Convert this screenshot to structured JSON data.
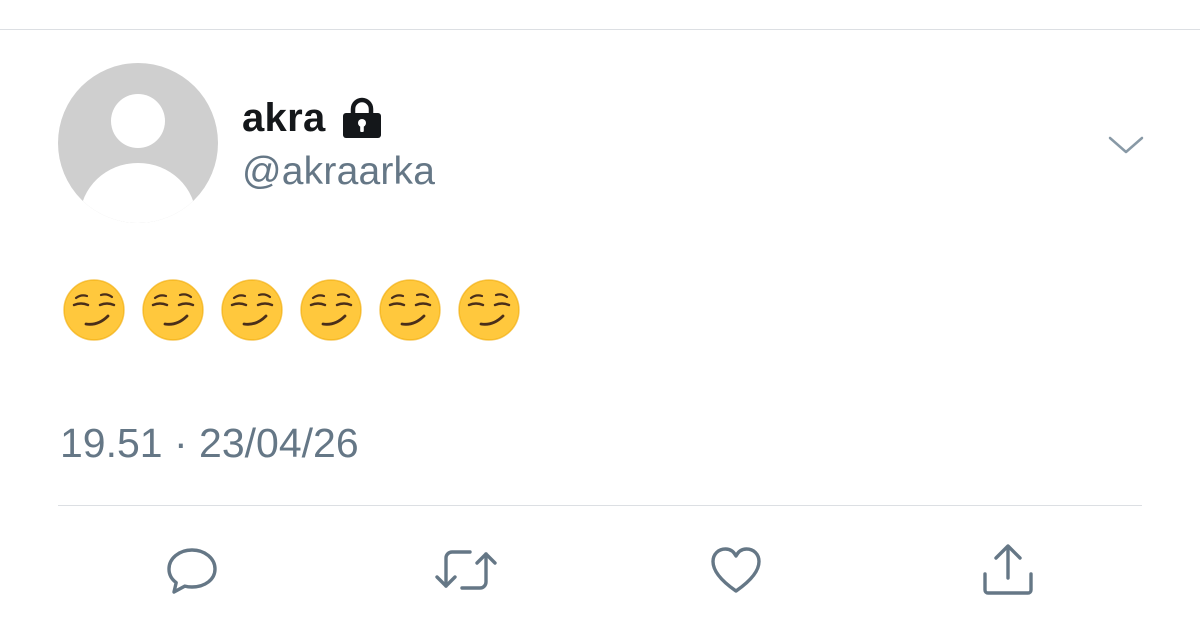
{
  "tweet": {
    "display_name": "akra",
    "handle": "@akraarka",
    "body_emojis": [
      "smirking-face",
      "smirking-face",
      "smirking-face",
      "smirking-face",
      "smirking-face",
      "smirking-face"
    ],
    "timestamp": "19.51 · 23/04/26"
  },
  "icons": {
    "protected": "lock-icon",
    "menu": "chevron-down-icon",
    "reply": "reply-icon",
    "retweet": "retweet-icon",
    "like": "heart-icon",
    "share": "share-icon"
  },
  "colors": {
    "name_text": "#14171a",
    "secondary_text": "#657786",
    "divider": "#dcdfe3",
    "avatar_placeholder": "#cfcfcf",
    "emoji_face": "#ffc83d"
  }
}
